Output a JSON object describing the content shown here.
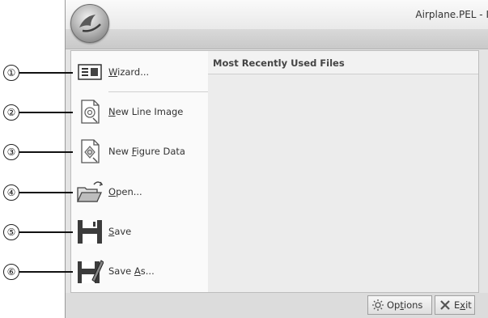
{
  "window": {
    "title": "Airplane.PEL - I"
  },
  "menu": {
    "items": [
      {
        "label_pre": "",
        "label_mn": "W",
        "label_post": "izard...",
        "icon": "wizard-icon"
      },
      {
        "label_pre": "",
        "label_mn": "N",
        "label_post": "ew Line Image",
        "icon": "new-line-image-icon"
      },
      {
        "label_pre": "New ",
        "label_mn": "F",
        "label_post": "igure Data",
        "icon": "new-figure-data-icon"
      },
      {
        "label_pre": "",
        "label_mn": "O",
        "label_post": "pen...",
        "icon": "open-folder-icon"
      },
      {
        "label_pre": "",
        "label_mn": "S",
        "label_post": "ave",
        "icon": "save-icon"
      },
      {
        "label_pre": "Save ",
        "label_mn": "A",
        "label_post": "s...",
        "icon": "save-as-icon"
      }
    ]
  },
  "mru": {
    "header": "Most Recently Used Files"
  },
  "buttons": {
    "options_pre": "Op",
    "options_mn": "t",
    "options_post": "ions",
    "exit_pre": "E",
    "exit_mn": "x",
    "exit_post": "it"
  },
  "callouts": [
    "①",
    "②",
    "③",
    "④",
    "⑤",
    "⑥"
  ]
}
